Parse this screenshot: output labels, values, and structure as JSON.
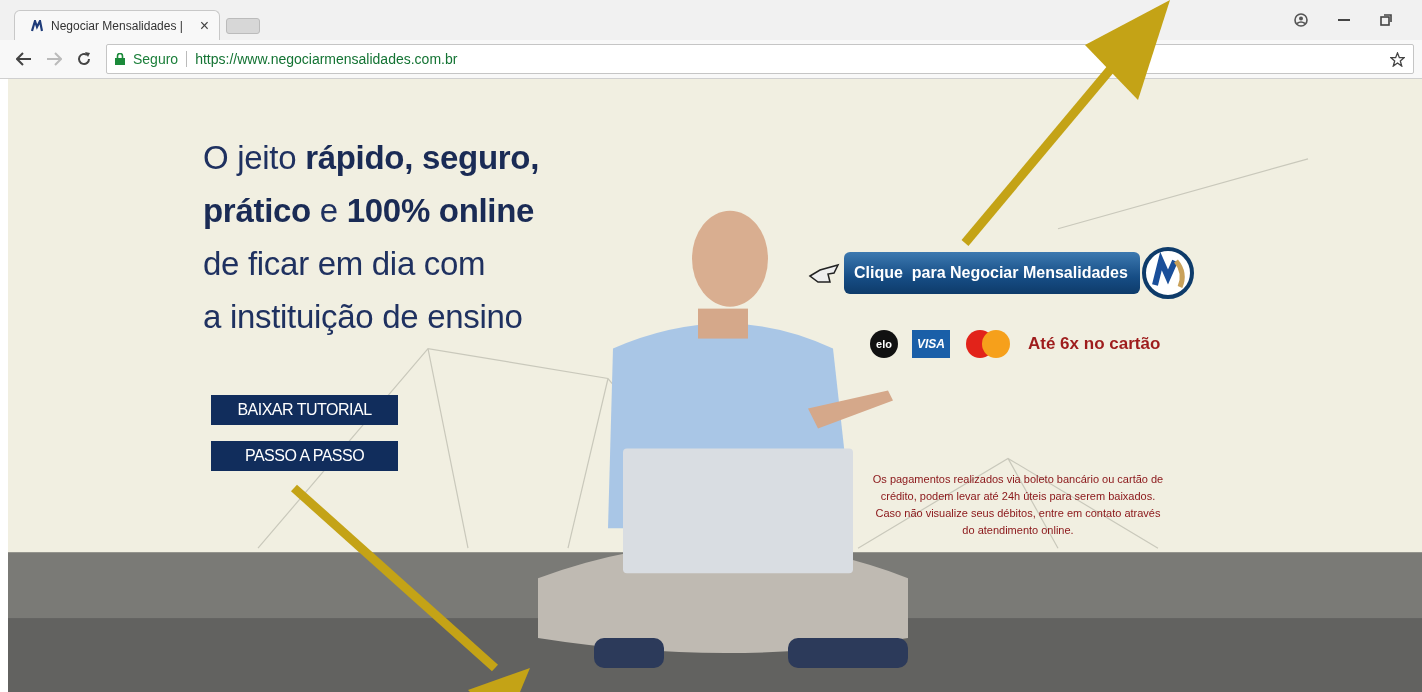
{
  "browser": {
    "tab": {
      "title": "Negociar Mensalidades |",
      "close": "×"
    },
    "address": {
      "secure_label": "Seguro",
      "url": "https://www.negociarmensalidades.com.br"
    }
  },
  "page": {
    "headline_lines": [
      "O jeito **rápido, seguro,**",
      "**prático** e **100% online**",
      "de ficar em dia com",
      "a instituição de ensino"
    ],
    "buttons": [
      "BAIXAR TUTORIAL",
      "PASSO A PASSO"
    ],
    "cta": {
      "label": "Clique  para Negociar Mensalidades"
    },
    "cards": [
      {
        "kind": "elo",
        "label": "elo"
      },
      {
        "kind": "visa",
        "label": "VISA"
      },
      {
        "kind": "mastercard"
      }
    ],
    "installments": "Até 6x no cartão",
    "notice": "Os pagamentos realizados via boleto bancário ou cartão de crédito, podem levar até 24h úteis para serem baixados. Caso não visualize seus débitos, entre em contato através do atendimento online."
  }
}
